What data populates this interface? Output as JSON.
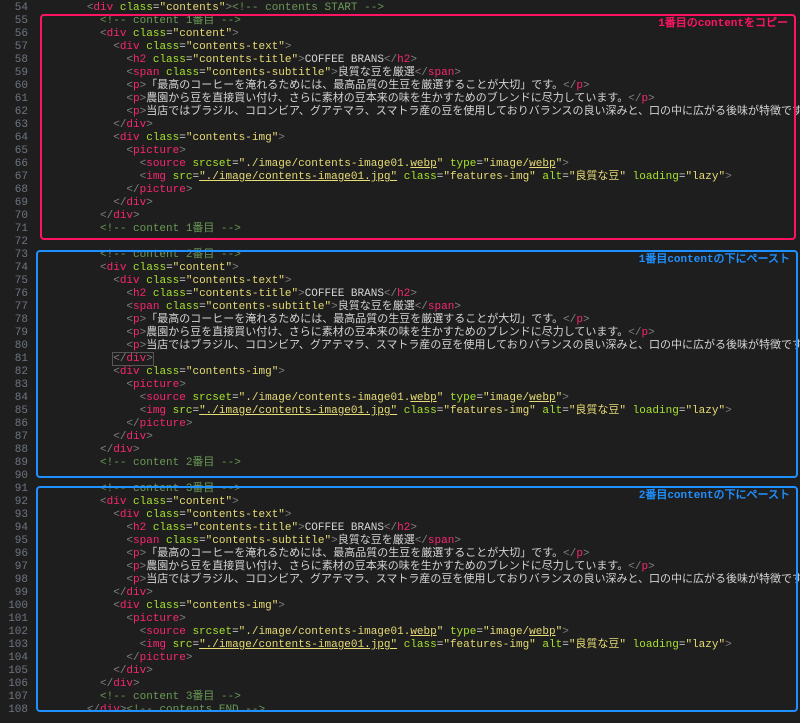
{
  "first_line_no": 54,
  "annotations": {
    "box1_label": "1番目のcontentをコピー",
    "box2_label": "1番目contentの下にペースト",
    "box3_label": "2番目contentの下にペースト"
  },
  "strings": {
    "contents": "contents",
    "content": "content",
    "contents_text": "contents-text",
    "contents_title": "contents-title",
    "contents_subtitle": "contents-subtitle",
    "contents_img": "contents-img",
    "features_img": "features-img",
    "title_text": "COFFEE BRANS",
    "subtitle_text": "良質な豆を厳選",
    "p1": "「最高のコーヒーを淹れるためには、最高品質の生豆を厳選することが大切」です。",
    "p2": "農園から豆を直接買い付け、さらに素材の豆本来の味を生かすためのブレンドに尽力しています。",
    "p3": "当店ではブラジル、コロンビア、グアテマラ、スマトラ産の豆を使用しておりバランスの良い深みと、口の中に広がる後味が特徴です。",
    "srcset": "./image/contents-image01.webp",
    "type_webp": "image/webp",
    "img_src": "./image/contents-image01.jpg",
    "img_alt": "良質な豆",
    "lazy": "lazy",
    "cmt_contents_start": " contents START ",
    "cmt_contents_end": " contents END ",
    "cmt_c1s": " content 1番目 ",
    "cmt_c2s": " content 2番目 ",
    "cmt_c3s": " content 3番目 "
  },
  "lines": [
    {
      "i": 4,
      "t": "open",
      "tag": "div",
      "attrs": [
        [
          "class",
          "contents"
        ]
      ],
      "trail_cmt": "cmt_contents_start"
    },
    {
      "i": 5,
      "t": "cmt",
      "k": "cmt_c1s"
    },
    {
      "i": 5,
      "t": "open",
      "tag": "div",
      "attrs": [
        [
          "class",
          "content"
        ]
      ]
    },
    {
      "i": 6,
      "t": "open",
      "tag": "div",
      "attrs": [
        [
          "class",
          "contents_text"
        ]
      ]
    },
    {
      "i": 7,
      "t": "pair",
      "tag": "h2",
      "attrs": [
        [
          "class",
          "contents_title"
        ]
      ],
      "txt": "title_text"
    },
    {
      "i": 7,
      "t": "pair",
      "tag": "span",
      "attrs": [
        [
          "class",
          "contents_subtitle"
        ]
      ],
      "txt": "subtitle_text"
    },
    {
      "i": 7,
      "t": "pair",
      "tag": "p",
      "txt": "p1"
    },
    {
      "i": 7,
      "t": "pair",
      "tag": "p",
      "txt": "p2"
    },
    {
      "i": 7,
      "t": "pair",
      "tag": "p",
      "txt": "p3"
    },
    {
      "i": 6,
      "t": "close",
      "tag": "div"
    },
    {
      "i": 6,
      "t": "open",
      "tag": "div",
      "attrs": [
        [
          "class",
          "contents_img"
        ]
      ]
    },
    {
      "i": 7,
      "t": "open",
      "tag": "picture"
    },
    {
      "i": 8,
      "t": "self",
      "tag": "source",
      "attrs": [
        [
          "srcset",
          "srcset"
        ],
        [
          "type",
          "type_webp"
        ]
      ],
      "u": [
        "webp"
      ]
    },
    {
      "i": 8,
      "t": "self",
      "tag": "img",
      "attrs": [
        [
          "src",
          "img_src"
        ],
        [
          "class",
          "features_img"
        ],
        [
          "alt",
          "img_alt"
        ],
        [
          "loading",
          "lazy"
        ]
      ],
      "u": [
        "img_src"
      ]
    },
    {
      "i": 7,
      "t": "close",
      "tag": "picture"
    },
    {
      "i": 6,
      "t": "close",
      "tag": "div"
    },
    {
      "i": 5,
      "t": "close",
      "tag": "div"
    },
    {
      "i": 5,
      "t": "cmt",
      "k": "cmt_c1s"
    },
    {
      "i": 0,
      "t": "blank"
    },
    {
      "i": 5,
      "t": "cmt",
      "k": "cmt_c2s"
    },
    {
      "i": 5,
      "t": "open",
      "tag": "div",
      "attrs": [
        [
          "class",
          "content"
        ]
      ]
    },
    {
      "i": 6,
      "t": "open",
      "tag": "div",
      "attrs": [
        [
          "class",
          "contents_text"
        ]
      ]
    },
    {
      "i": 7,
      "t": "pair",
      "tag": "h2",
      "attrs": [
        [
          "class",
          "contents_title"
        ]
      ],
      "txt": "title_text"
    },
    {
      "i": 7,
      "t": "pair",
      "tag": "span",
      "attrs": [
        [
          "class",
          "contents_subtitle"
        ]
      ],
      "txt": "subtitle_text"
    },
    {
      "i": 7,
      "t": "pair",
      "tag": "p",
      "txt": "p1"
    },
    {
      "i": 7,
      "t": "pair",
      "tag": "p",
      "txt": "p2"
    },
    {
      "i": 7,
      "t": "pair",
      "tag": "p",
      "txt": "p3"
    },
    {
      "i": 6,
      "t": "closebox",
      "tag": "div"
    },
    {
      "i": 6,
      "t": "open",
      "tag": "div",
      "attrs": [
        [
          "class",
          "contents_img"
        ]
      ]
    },
    {
      "i": 7,
      "t": "open",
      "tag": "picture"
    },
    {
      "i": 8,
      "t": "self",
      "tag": "source",
      "attrs": [
        [
          "srcset",
          "srcset"
        ],
        [
          "type",
          "type_webp"
        ]
      ],
      "u": [
        "webp"
      ]
    },
    {
      "i": 8,
      "t": "self",
      "tag": "img",
      "attrs": [
        [
          "src",
          "img_src"
        ],
        [
          "class",
          "features_img"
        ],
        [
          "alt",
          "img_alt"
        ],
        [
          "loading",
          "lazy"
        ]
      ],
      "u": [
        "img_src"
      ]
    },
    {
      "i": 7,
      "t": "close",
      "tag": "picture"
    },
    {
      "i": 6,
      "t": "close",
      "tag": "div"
    },
    {
      "i": 5,
      "t": "close",
      "tag": "div"
    },
    {
      "i": 5,
      "t": "cmt",
      "k": "cmt_c2s"
    },
    {
      "i": 0,
      "t": "blank"
    },
    {
      "i": 5,
      "t": "cmt",
      "k": "cmt_c3s"
    },
    {
      "i": 5,
      "t": "open",
      "tag": "div",
      "attrs": [
        [
          "class",
          "content"
        ]
      ]
    },
    {
      "i": 6,
      "t": "open",
      "tag": "div",
      "attrs": [
        [
          "class",
          "contents_text"
        ]
      ]
    },
    {
      "i": 7,
      "t": "pair",
      "tag": "h2",
      "attrs": [
        [
          "class",
          "contents_title"
        ]
      ],
      "txt": "title_text"
    },
    {
      "i": 7,
      "t": "pair",
      "tag": "span",
      "attrs": [
        [
          "class",
          "contents_subtitle"
        ]
      ],
      "txt": "subtitle_text"
    },
    {
      "i": 7,
      "t": "pair",
      "tag": "p",
      "txt": "p1"
    },
    {
      "i": 7,
      "t": "pair",
      "tag": "p",
      "txt": "p2"
    },
    {
      "i": 7,
      "t": "pair",
      "tag": "p",
      "txt": "p3"
    },
    {
      "i": 6,
      "t": "close",
      "tag": "div"
    },
    {
      "i": 6,
      "t": "open",
      "tag": "div",
      "attrs": [
        [
          "class",
          "contents_img"
        ]
      ]
    },
    {
      "i": 7,
      "t": "open",
      "tag": "picture"
    },
    {
      "i": 8,
      "t": "self",
      "tag": "source",
      "attrs": [
        [
          "srcset",
          "srcset"
        ],
        [
          "type",
          "type_webp"
        ]
      ],
      "u": [
        "webp"
      ]
    },
    {
      "i": 8,
      "t": "self",
      "tag": "img",
      "attrs": [
        [
          "src",
          "img_src"
        ],
        [
          "class",
          "features_img"
        ],
        [
          "alt",
          "img_alt"
        ],
        [
          "loading",
          "lazy"
        ]
      ],
      "u": [
        "img_src"
      ]
    },
    {
      "i": 7,
      "t": "close",
      "tag": "picture"
    },
    {
      "i": 6,
      "t": "close",
      "tag": "div"
    },
    {
      "i": 5,
      "t": "close",
      "tag": "div"
    },
    {
      "i": 5,
      "t": "cmt",
      "k": "cmt_c3s"
    },
    {
      "i": 4,
      "t": "close",
      "tag": "div",
      "trail_cmt": "cmt_contents_end"
    }
  ]
}
